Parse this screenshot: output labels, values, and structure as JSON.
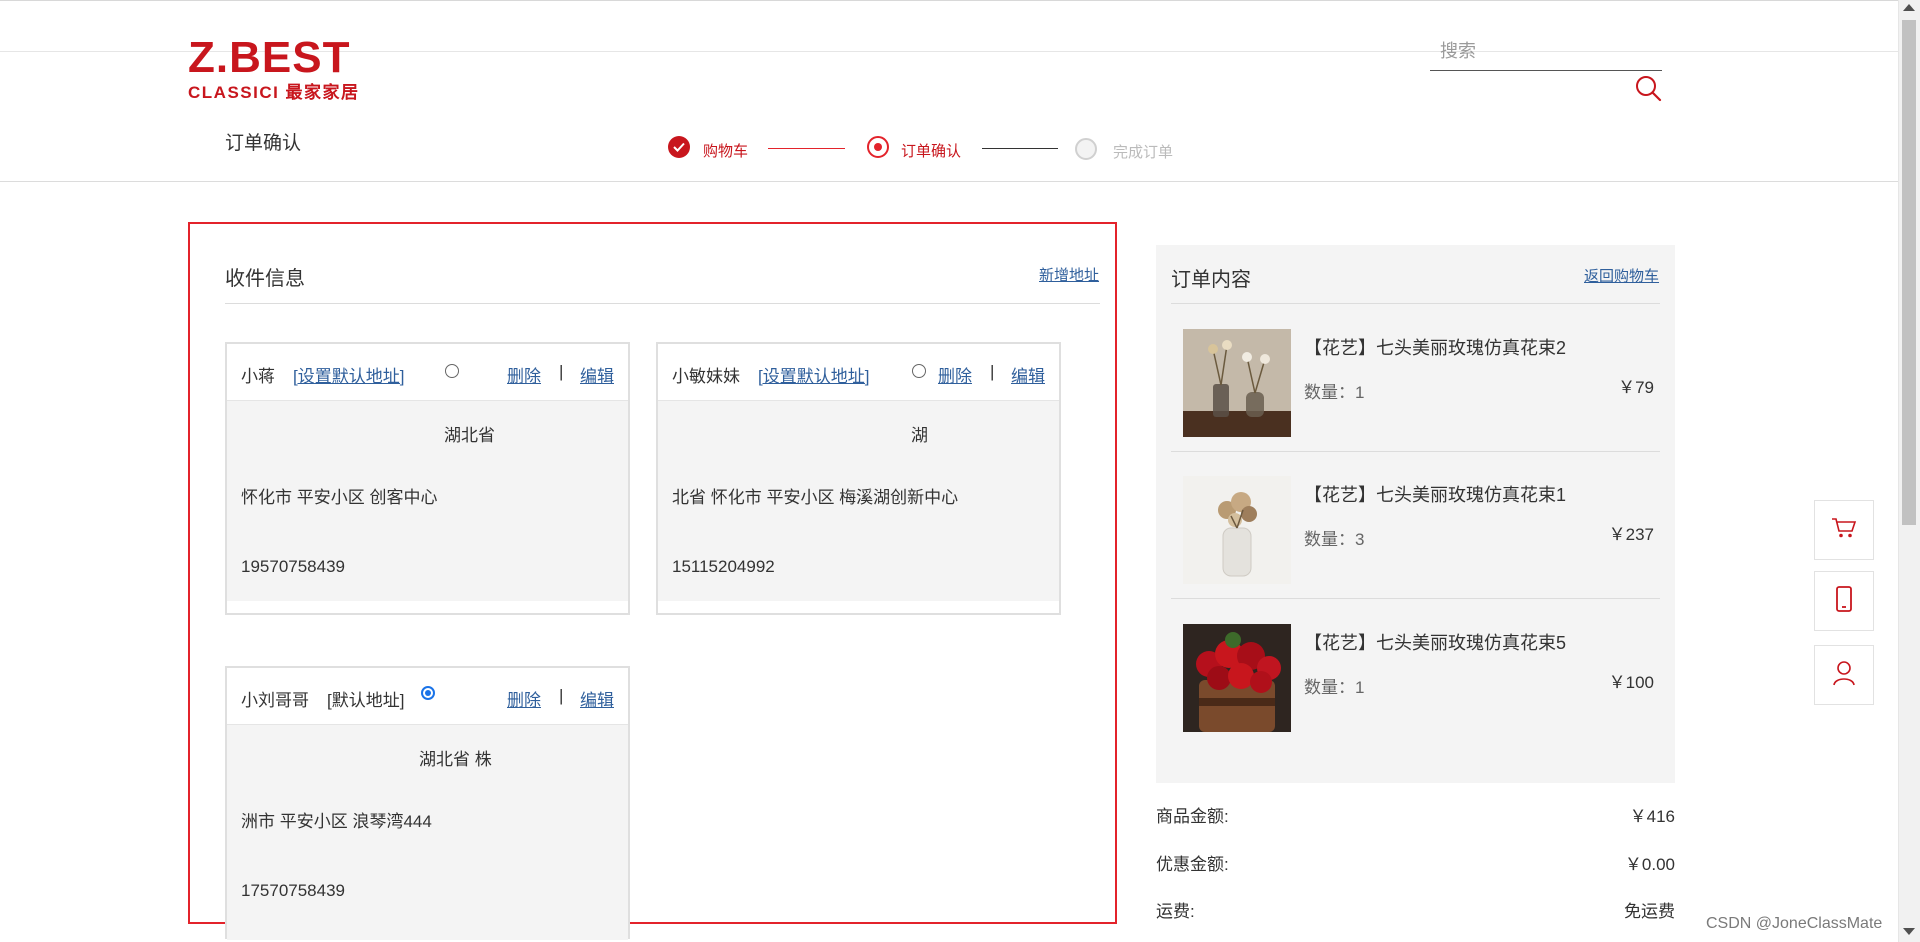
{
  "colors": {
    "brand": "#c8161d",
    "accent_red": "#e3232b",
    "link": "#2f5f9c",
    "muted": "#bbbbbb"
  },
  "header": {
    "logo_main": "Z.BEST",
    "logo_sub": "CLASSICI 最家家居",
    "search_placeholder": "搜索",
    "page_title": "订单确认"
  },
  "steps": [
    {
      "label": "购物车",
      "state": "done",
      "icon": "check-icon"
    },
    {
      "label": "订单确认",
      "state": "current",
      "icon": "dot-icon"
    },
    {
      "label": "完成订单",
      "state": "pending",
      "icon": "empty-circle-icon"
    }
  ],
  "receiver": {
    "title": "收件信息",
    "add_link": "新增地址",
    "cards": [
      {
        "name": "小蒋",
        "tag": "[设置默认地址]",
        "tag_is_link": true,
        "selected": false,
        "delete": "删除",
        "sep": "|",
        "edit": "编辑",
        "line1": "湖北省",
        "line2": "怀化市 平安小区 创客中心",
        "phone": "19570758439"
      },
      {
        "name": "小敏妹妹",
        "tag": "[设置默认地址]",
        "tag_is_link": true,
        "selected": false,
        "delete": "删除",
        "sep": "|",
        "edit": "编辑",
        "line1": "湖",
        "line2": "北省 怀化市 平安小区 梅溪湖创新中心",
        "phone": "15115204992"
      },
      {
        "name": "小刘哥哥",
        "tag": "[默认地址]",
        "tag_is_link": false,
        "selected": true,
        "delete": "删除",
        "sep": "|",
        "edit": "编辑",
        "line1": "湖北省 株",
        "line2": "洲市 平安小区 浪琴湾444",
        "phone": "17570758439"
      }
    ]
  },
  "order": {
    "title": "订单内容",
    "back_link": "返回购物车",
    "items": [
      {
        "name": "【花艺】七头美丽玫瑰仿真花束2",
        "qty": "数量：1",
        "price": "￥79"
      },
      {
        "name": "【花艺】七头美丽玫瑰仿真花束1",
        "qty": "数量：3",
        "price": "￥237"
      },
      {
        "name": "【花艺】七头美丽玫瑰仿真花束5",
        "qty": "数量：1",
        "price": "￥100"
      }
    ],
    "summary": [
      {
        "label": "商品金额:",
        "value": "￥416"
      },
      {
        "label": "优惠金额:",
        "value": "￥0.00"
      },
      {
        "label": "运费:",
        "value": "免运费"
      }
    ]
  },
  "side_tools": [
    {
      "icon": "cart-icon"
    },
    {
      "icon": "phone-icon"
    },
    {
      "icon": "user-icon"
    }
  ],
  "watermark": "CSDN @JoneClassMate"
}
